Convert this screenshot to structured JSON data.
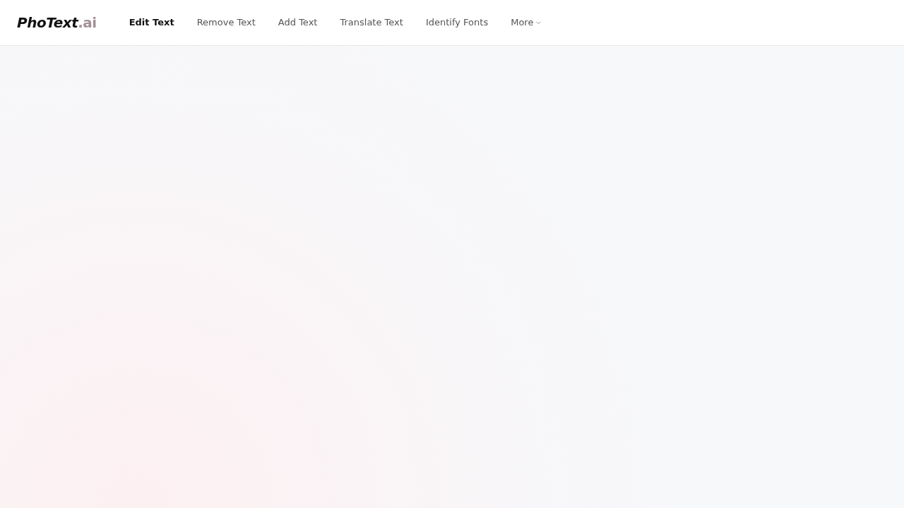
{
  "logo": {
    "name": "PhoText",
    "suffix": ".ai"
  },
  "nav": [
    {
      "label": "Edit Text",
      "selected": true
    },
    {
      "label": "Remove Text",
      "selected": false
    },
    {
      "label": "Add Text",
      "selected": false
    },
    {
      "label": "Translate Text",
      "selected": false
    },
    {
      "label": "Identify Fonts",
      "selected": false
    },
    {
      "label": "More",
      "selected": false,
      "kind": "dropdown"
    }
  ]
}
